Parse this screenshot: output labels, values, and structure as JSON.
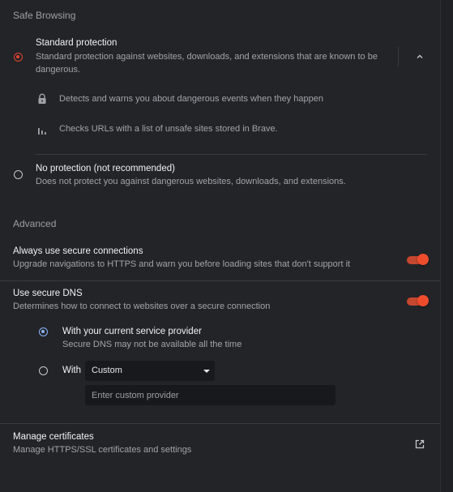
{
  "safe_browsing": {
    "heading": "Safe Browsing",
    "standard": {
      "title": "Standard protection",
      "description": "Standard protection against websites, downloads, and extensions that are known to be dangerous.",
      "selected": true,
      "details": [
        {
          "icon": "lock-icon",
          "text": "Detects and warns you about dangerous events when they happen"
        },
        {
          "icon": "bar-chart-icon",
          "text": "Checks URLs with a list of unsafe sites stored in Brave."
        }
      ]
    },
    "no_protection": {
      "title": "No protection (not recommended)",
      "description": "Does not protect you against dangerous websites, downloads, and extensions.",
      "selected": false
    }
  },
  "advanced": {
    "heading": "Advanced",
    "secure_connections": {
      "title": "Always use secure connections",
      "description": "Upgrade navigations to HTTPS and warn you before loading sites that don't support it",
      "enabled": true
    },
    "secure_dns": {
      "title": "Use secure DNS",
      "description": "Determines how to connect to websites over a secure connection",
      "enabled": true,
      "option_current": {
        "title": "With your current service provider",
        "description": "Secure DNS may not be available all the time",
        "selected": true
      },
      "option_custom": {
        "label": "With",
        "selected": false,
        "select_value": "Custom",
        "input_placeholder": "Enter custom provider",
        "input_value": ""
      }
    },
    "certificates": {
      "title": "Manage certificates",
      "description": "Manage HTTPS/SSL certificates and settings"
    }
  },
  "colors": {
    "accent_red": "#e2462e",
    "accent_blue": "#8ab4f8",
    "background": "#232428"
  }
}
